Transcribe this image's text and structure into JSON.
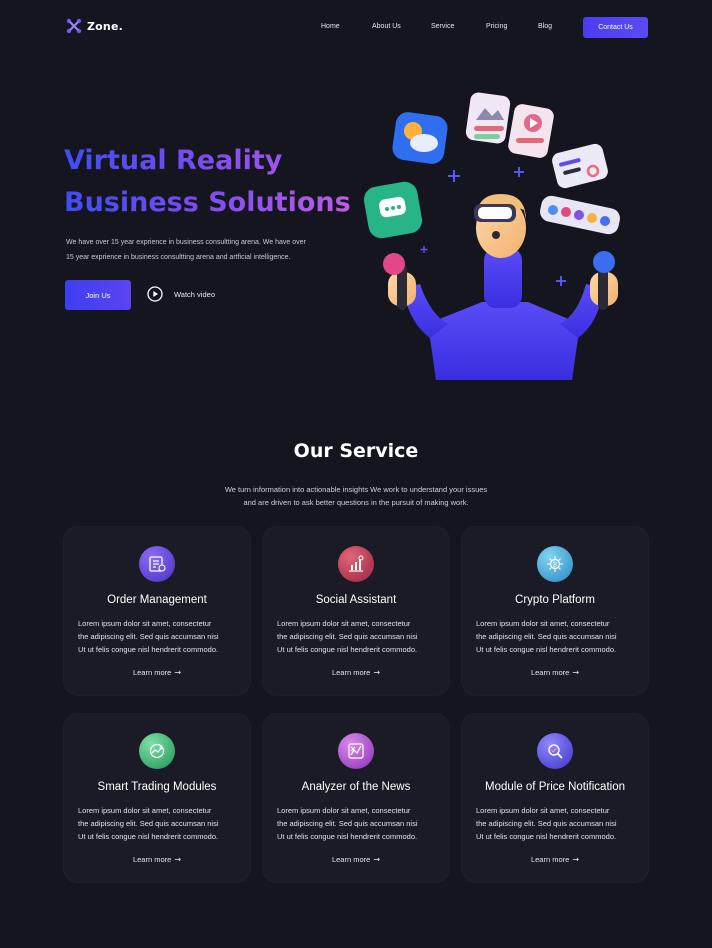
{
  "brand": {
    "name": "Zone."
  },
  "nav": {
    "links": [
      "Home",
      "About Us",
      "Service",
      "Pricing",
      "Blog"
    ],
    "cta": "Contact Us"
  },
  "hero": {
    "title_line1": "Virtual Reality",
    "title_line2": "Business Solutions",
    "desc_line1": "We have over 15 year exprience in business consultting arena. We have over",
    "desc_line2": "15 year exprience in business consultting arena and artficial intelligence.",
    "join_label": "Join Us",
    "watch_label": "Watch video"
  },
  "services": {
    "title": "Our Service",
    "desc_line1": "We turn information into actionable insights We work to understand your issues",
    "desc_line2": "and are driven to ask better questions in the pursuit of making work.",
    "cards": [
      {
        "title": "Order Management",
        "icon": "order-icon",
        "color": "#5b3fd6",
        "line1": "Lorem ipsum dolor sit amet, consectetur",
        "line2": "the adipiscing elit. Sed quis accumsan nisi",
        "line3": "Ut ut felis congue nisl hendrerit commodo.",
        "learn": "Learn more"
      },
      {
        "title": "Social Assistant",
        "icon": "chart-icon",
        "color": "#c0364d",
        "line1": "Lorem ipsum dolor sit amet, consectetur",
        "line2": "the adipiscing elit. Sed quis accumsan nisi",
        "line3": "Ut ut felis congue nisl hendrerit commodo.",
        "learn": "Learn more"
      },
      {
        "title": "Crypto Platform",
        "icon": "crypto-icon",
        "color": "#3aa6d6",
        "line1": "Lorem ipsum dolor sit amet, consectetur",
        "line2": "the adipiscing elit. Sed quis accumsan nisi",
        "line3": "Ut ut felis congue nisl hendrerit commodo.",
        "learn": "Learn more"
      },
      {
        "title": "Smart Trading Modules",
        "icon": "trading-icon",
        "color": "#2fb36a",
        "line1": "Lorem ipsum dolor sit amet, consectetur",
        "line2": "the adipiscing elit. Sed quis accumsan nisi",
        "line3": "Ut ut felis congue nisl hendrerit commodo.",
        "learn": "Learn more"
      },
      {
        "title": "Analyzer of the News",
        "icon": "analyzer-icon",
        "color": "#b04bd0",
        "line1": "Lorem ipsum dolor sit amet, consectetur",
        "line2": "the adipiscing elit. Sed quis accumsan nisi",
        "line3": "Ut ut felis congue nisl hendrerit commodo.",
        "learn": "Learn more"
      },
      {
        "title": "Module of Price Notification",
        "icon": "price-search-icon",
        "color": "#5a4fe0",
        "line1": "Lorem ipsum dolor sit amet, consectetur",
        "line2": "the adipiscing elit. Sed quis accumsan nisi",
        "line3": "Ut ut felis congue nisl hendrerit commodo.",
        "learn": "Learn more"
      }
    ]
  },
  "colors": {
    "background": "#14151f",
    "card": "#1a1b26",
    "accent": "#4b3cf0"
  }
}
